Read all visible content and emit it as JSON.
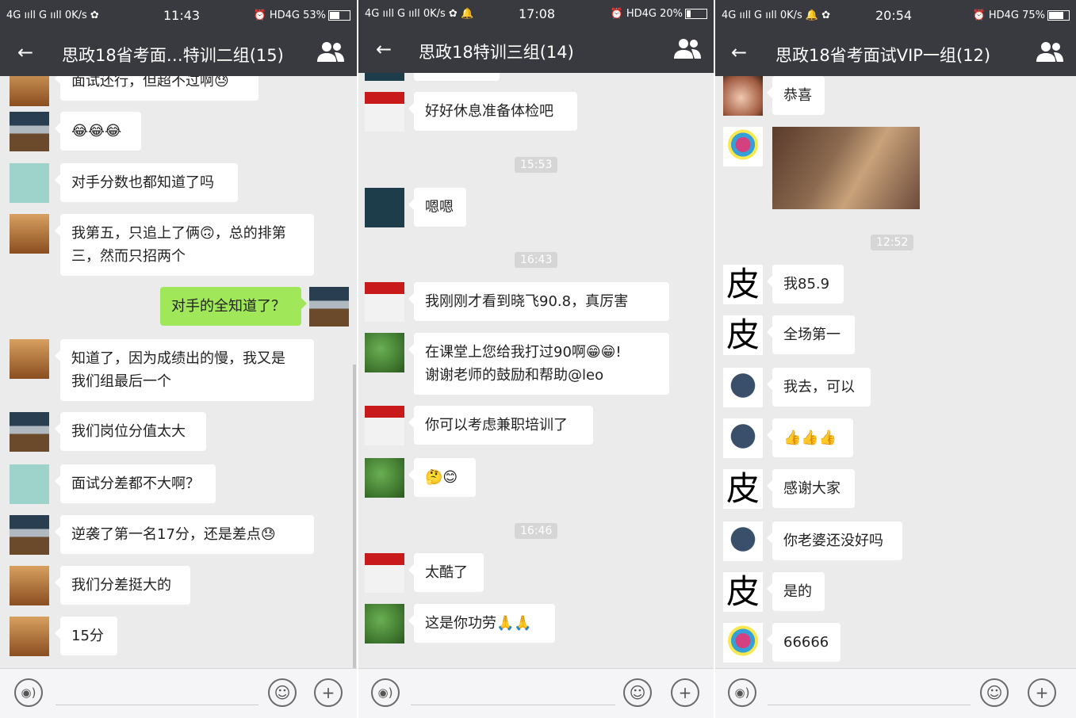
{
  "panels": [
    {
      "status": {
        "left": "4G ııll G ııll 0K/s ✿",
        "time": "11:43",
        "right": "⏰ HD4G 53%"
      },
      "title": "思政18省考面…特训二组(15)",
      "messages": [
        {
          "text": "面试还行，但超不过啊😓"
        },
        {
          "text": "😂😂😂"
        },
        {
          "text": "对手分数也都知道了吗"
        },
        {
          "text": "我第五，只追上了俩🙃，总的排第\n三，然而只招两个"
        },
        {
          "text": "对手的全知道了？"
        },
        {
          "text": "知道了，因为成绩出的慢，我又是\n我们组最后一个"
        },
        {
          "text": "我们岗位分值太大"
        },
        {
          "text": "面试分差都不大啊？"
        },
        {
          "text": "逆袭了第一名17分，还是差点😓"
        },
        {
          "text": "我们分差挺大的"
        },
        {
          "text": "15分"
        }
      ]
    },
    {
      "status": {
        "left": "4G ııll G ııll 0K/s ✿ 🔔",
        "time": "17:08",
        "right": "⏰ HD4G 20%"
      },
      "title": "思政18特训三组(14)",
      "messages": [
        {
          "text": "好好休息准备体检吧"
        },
        {
          "text": "嗯嗯"
        },
        {
          "text": "我刚刚才看到晓飞90.8，真厉害"
        },
        {
          "text": "在课堂上您给我打过90啊😁😁!\n谢谢老师的鼓励和帮助@leo"
        },
        {
          "text": "你可以考虑兼职培训了"
        },
        {
          "text": "🤔😊"
        },
        {
          "text": "太酷了"
        },
        {
          "text": "这是你功劳🙏🙏"
        }
      ],
      "times": [
        "15:53",
        "16:43",
        "16:46"
      ]
    },
    {
      "status": {
        "left": "4G ııll G ııll 0K/s 🔔 ✿",
        "time": "20:54",
        "right": "⏰ HD4G 75%"
      },
      "title": "思政18省考面试VIP一组(12)",
      "messages": [
        {
          "text": "恭喜"
        },
        {
          "text": "我85.9"
        },
        {
          "text": "全场第一"
        },
        {
          "text": "我去，可以"
        },
        {
          "text": "👍👍👍"
        },
        {
          "text": "感谢大家"
        },
        {
          "text": "你老婆还没好吗"
        },
        {
          "text": "是的"
        },
        {
          "text": "66666"
        }
      ],
      "times": [
        "12:52"
      ],
      "avatar_text": "皮"
    }
  ],
  "colors": {
    "titlebar": "#393a3f",
    "chat_bg": "#ebebeb",
    "outgoing": "#a0e75a"
  }
}
